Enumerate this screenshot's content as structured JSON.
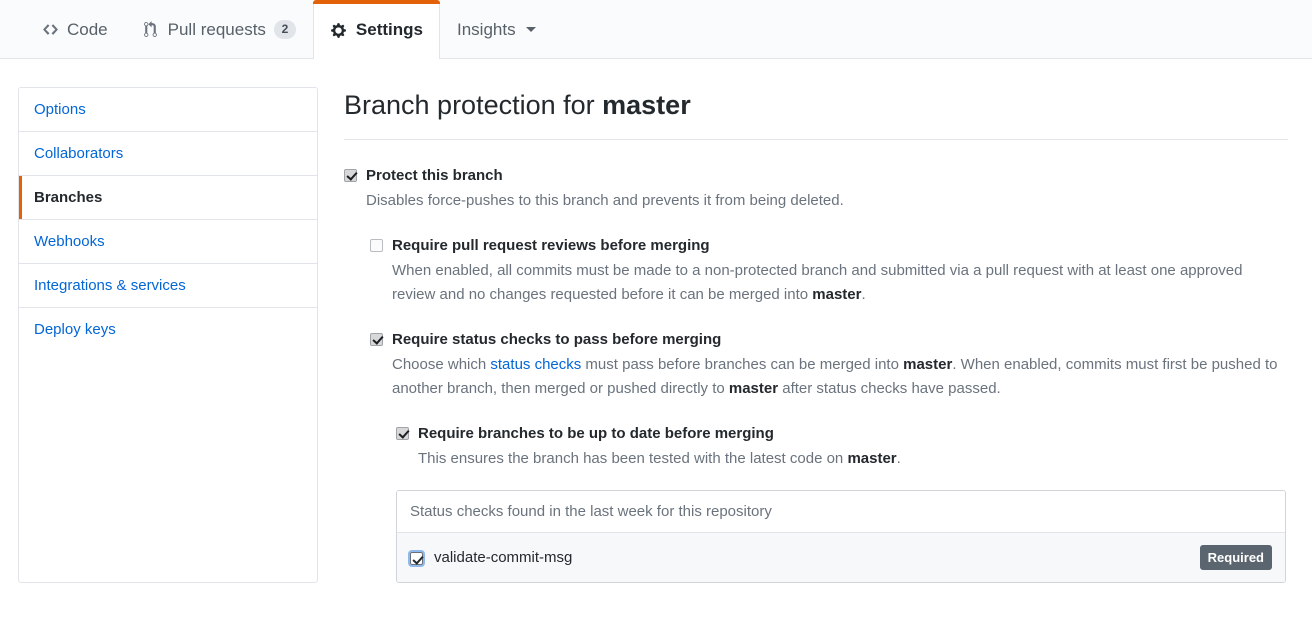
{
  "tabnav": {
    "tabs": [
      {
        "label": "Code",
        "icon": "code-icon",
        "counter": null,
        "selected": false,
        "caret": false
      },
      {
        "label": "Pull requests",
        "icon": "git-pull-request-icon",
        "counter": "2",
        "selected": false,
        "caret": false
      },
      {
        "label": "Settings",
        "icon": "gear-icon",
        "counter": null,
        "selected": true,
        "caret": false
      },
      {
        "label": "Insights",
        "icon": null,
        "counter": null,
        "selected": false,
        "caret": true
      }
    ],
    "accent_color": "#e36209"
  },
  "sidebar": {
    "items": [
      {
        "label": "Options",
        "selected": false
      },
      {
        "label": "Collaborators",
        "selected": false
      },
      {
        "label": "Branches",
        "selected": true
      },
      {
        "label": "Webhooks",
        "selected": false
      },
      {
        "label": "Integrations & services",
        "selected": false
      },
      {
        "label": "Deploy keys",
        "selected": false
      }
    ]
  },
  "main": {
    "title_prefix": "Branch protection for ",
    "title_branch": "master",
    "fields": {
      "protect_branch": {
        "label": "Protect this branch",
        "checked": true,
        "note_before": "Disables force-pushes to this branch and prevents it from being deleted."
      },
      "require_reviews": {
        "label": "Require pull request reviews before merging",
        "checked": false,
        "note_a": "When enabled, all commits must be made to a non-protected branch and submitted via a pull request with at least one approved review and no changes requested before it can be merged into ",
        "note_branch": "master",
        "note_b": "."
      },
      "require_status_checks": {
        "label": "Require status checks to pass before merging",
        "checked": true,
        "note_a": "Choose which ",
        "note_link": "status checks",
        "note_b": " must pass before branches can be merged into ",
        "note_branch_1": "master",
        "note_c": ". When enabled, commits must first be pushed to another branch, then merged or pushed directly to ",
        "note_branch_2": "master",
        "note_d": " after status checks have passed."
      },
      "require_up_to_date": {
        "label": "Require branches to be up to date before merging",
        "checked": true,
        "note_a": "This ensures the branch has been tested with the latest code on ",
        "note_branch": "master",
        "note_b": "."
      }
    },
    "checks_box": {
      "header": "Status checks found in the last week for this repository",
      "rows": [
        {
          "name": "validate-commit-msg",
          "checked": true,
          "focused": true,
          "badge": "Required"
        }
      ]
    }
  }
}
